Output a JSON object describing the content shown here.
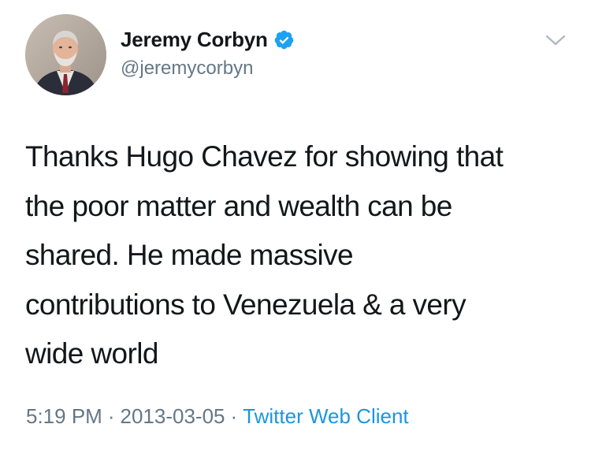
{
  "author": {
    "display_name": "Jeremy Corbyn",
    "handle": "@jeremycorbyn",
    "verified": true,
    "avatar": "profile-photo"
  },
  "tweet": {
    "text": "Thanks Hugo Chavez for showing that\nthe poor matter and wealth can be\nshared. He made massive\ncontributions to Venezuela & a very\nwide world",
    "time": "5:19 PM",
    "date": "2013-03-05",
    "separator": "·",
    "source": "Twitter Web Client"
  },
  "icons": {
    "verified": "verified-badge-icon",
    "menu": "chevron-down-icon"
  },
  "colors": {
    "text": "#14171a",
    "secondary": "#657786",
    "link": "#1b95e0",
    "verified": "#1da1f2"
  }
}
